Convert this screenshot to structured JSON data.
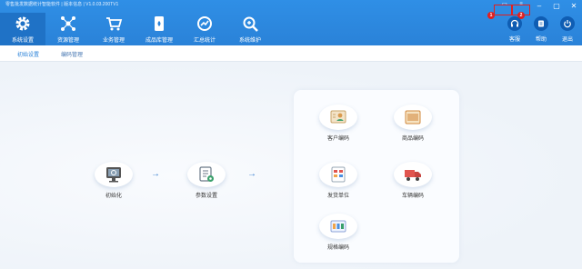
{
  "window": {
    "title": "零售批发数据统计智能软件 | 版本信息 | V1.0.03.200TV1",
    "controls": [
      "–",
      "▢",
      "✕"
    ]
  },
  "markers": [
    "1",
    "2"
  ],
  "nav": {
    "tabs": [
      {
        "label": "系统设置",
        "icon": "gear-icon",
        "active": true
      },
      {
        "label": "资源管理",
        "icon": "network-icon"
      },
      {
        "label": "业务管理",
        "icon": "cart-icon"
      },
      {
        "label": "成品库管理",
        "icon": "warehouse-icon"
      },
      {
        "label": "汇总统计",
        "icon": "chart-icon"
      },
      {
        "label": "系统维护",
        "icon": "maintenance-icon"
      }
    ],
    "actions": [
      {
        "label": "客服",
        "icon": "headset-icon"
      },
      {
        "label": "帮助",
        "icon": "help-icon"
      },
      {
        "label": "退出",
        "icon": "power-icon"
      }
    ]
  },
  "subtabs": [
    {
      "label": "初始设置",
      "active": true
    },
    {
      "label": "编码管理"
    }
  ],
  "workflow": {
    "steps": [
      {
        "label": "初始化",
        "icon": "monitor-icon"
      },
      {
        "label": "参数设置",
        "icon": "settings-doc-icon"
      }
    ],
    "codes": [
      {
        "label": "客户编码",
        "icon": "customer-card-icon"
      },
      {
        "label": "商品编码",
        "icon": "barcode-icon"
      },
      {
        "label": "发货单位",
        "icon": "shipping-unit-icon"
      },
      {
        "label": "车辆编码",
        "icon": "truck-icon"
      },
      {
        "label": "规格编码",
        "icon": "spec-code-icon"
      }
    ]
  },
  "colors": {
    "header": "#2a82d8",
    "active_tab": "#1f72c6",
    "accent": "#3a7fd0",
    "marker": "#e02020"
  }
}
